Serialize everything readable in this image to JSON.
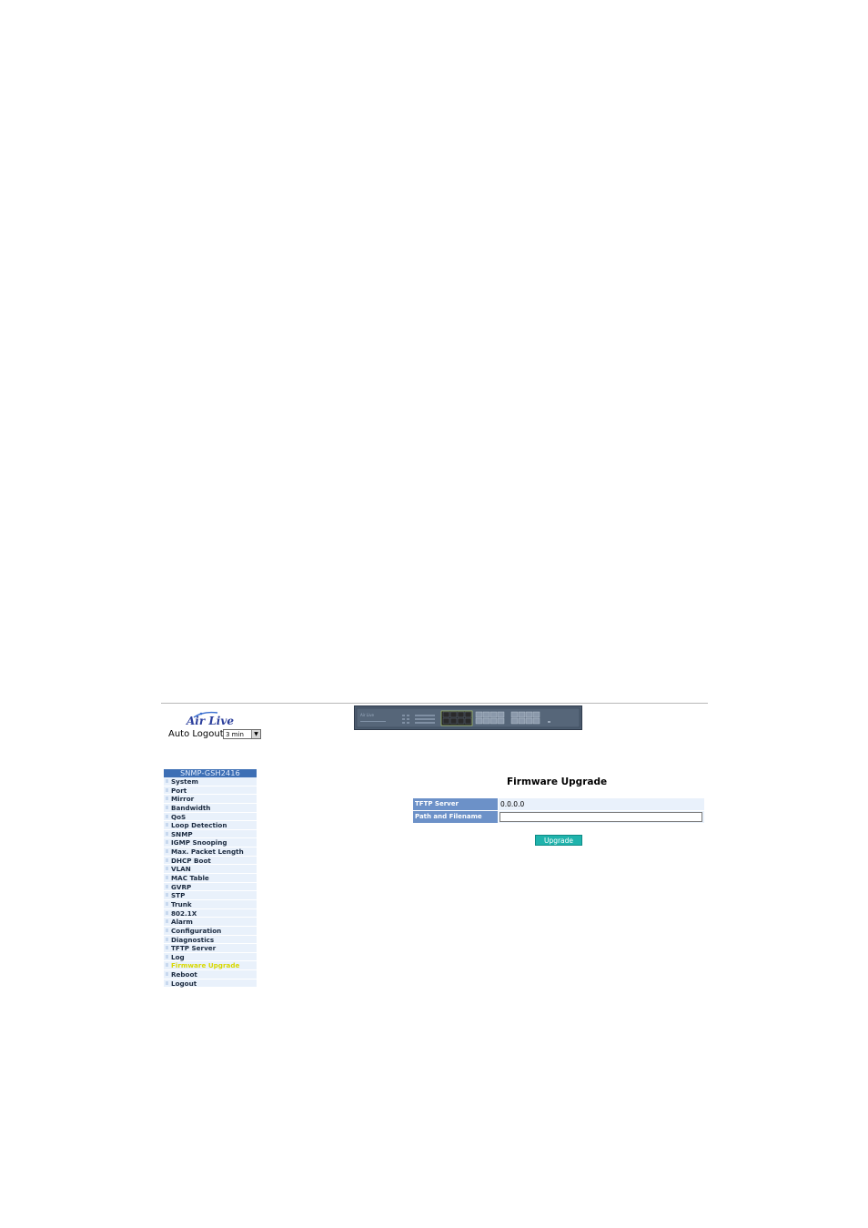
{
  "header": {
    "logo_text": "Air Live",
    "auto_logout_label": "Auto Logout",
    "auto_logout_value": "3 min"
  },
  "sidebar": {
    "title": "SNMP-GSH2416",
    "items": [
      {
        "label": "System"
      },
      {
        "label": "Port"
      },
      {
        "label": "Mirror"
      },
      {
        "label": "Bandwidth"
      },
      {
        "label": "QoS"
      },
      {
        "label": "Loop Detection"
      },
      {
        "label": "SNMP"
      },
      {
        "label": "IGMP Snooping"
      },
      {
        "label": "Max. Packet Length"
      },
      {
        "label": "DHCP Boot"
      },
      {
        "label": "VLAN"
      },
      {
        "label": "MAC Table"
      },
      {
        "label": "GVRP"
      },
      {
        "label": "STP"
      },
      {
        "label": "Trunk"
      },
      {
        "label": "802.1X"
      },
      {
        "label": "Alarm"
      },
      {
        "label": "Configuration"
      },
      {
        "label": "Diagnostics"
      },
      {
        "label": "TFTP Server"
      },
      {
        "label": "Log"
      },
      {
        "label": "Firmware Upgrade",
        "active": true
      },
      {
        "label": "Reboot"
      },
      {
        "label": "Logout"
      }
    ]
  },
  "main": {
    "title": "Firmware Upgrade",
    "tftp_server_label": "TFTP Server",
    "tftp_server_value": "0.0.0.0",
    "path_label": "Path and Filename",
    "path_value": "",
    "upgrade_button": "Upgrade"
  },
  "colors": {
    "sidebar_header": "#3d6fb5",
    "sidebar_item_bg": "#e9f1fb",
    "active_item_text": "#d8d800",
    "form_label_bg": "#6c91c8",
    "button_bg": "#1fb3ac"
  },
  "icons": [
    "airlive-logo",
    "switch-front-panel-image",
    "select-arrow-icon"
  ]
}
